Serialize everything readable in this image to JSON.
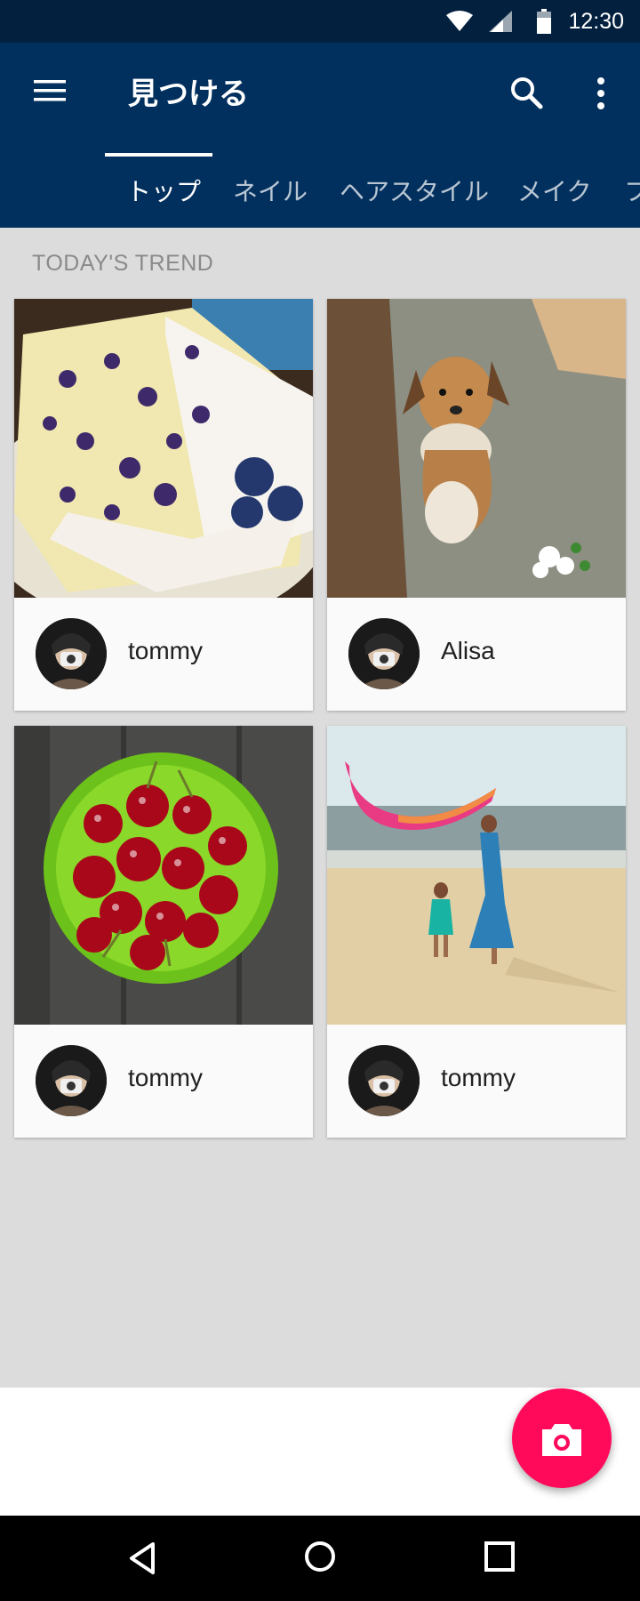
{
  "status_bar": {
    "time": "12:30",
    "icons": [
      "wifi-icon",
      "signal-icon",
      "battery-icon"
    ]
  },
  "app_bar": {
    "title": "見つける",
    "icons": [
      "menu-icon",
      "search-icon",
      "more-vert-icon"
    ],
    "background": "#02305e"
  },
  "tabs": [
    {
      "label": "トップ",
      "active": true
    },
    {
      "label": "ネイル",
      "active": false
    },
    {
      "label": "ヘアスタイル",
      "active": false
    },
    {
      "label": "メイク",
      "active": false
    },
    {
      "label": "フ",
      "active": false
    }
  ],
  "section_title": "TODAY'S TREND",
  "cards": [
    {
      "photo": "blueberry-cake",
      "username": "tommy"
    },
    {
      "photo": "dog",
      "username": "Alisa"
    },
    {
      "photo": "cherries",
      "username": "tommy"
    },
    {
      "photo": "beach",
      "username": "tommy"
    }
  ],
  "fab": {
    "icon": "camera-icon",
    "color": "#ff0a5a"
  },
  "nav_bar": {
    "icons": [
      "back-icon",
      "home-icon",
      "recents-icon"
    ]
  }
}
